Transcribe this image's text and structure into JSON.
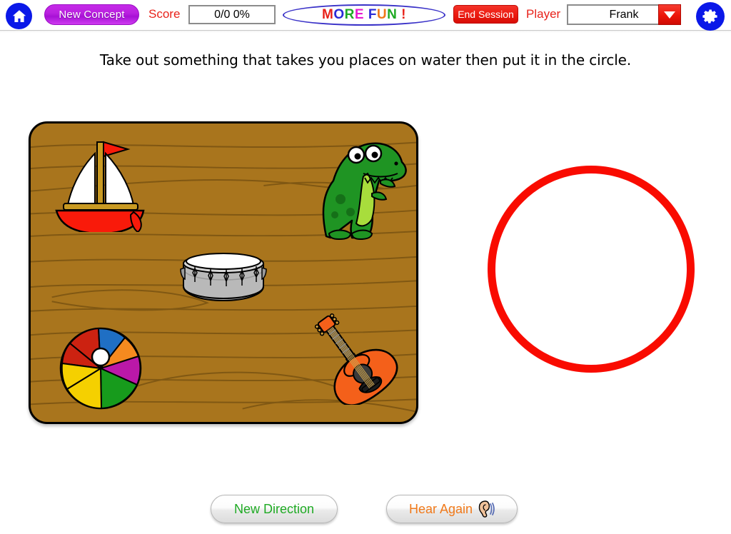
{
  "toolbar": {
    "home_icon": "home-icon",
    "new_concept_label": "New Concept",
    "score_label": "Score",
    "score_value": "0/0  0%",
    "more_fun": {
      "letters": [
        {
          "ch": "M",
          "color": "#e8221a"
        },
        {
          "ch": "O",
          "color": "#2b2bd6"
        },
        {
          "ch": "R",
          "color": "#1faa24"
        },
        {
          "ch": "E",
          "color": "#e81ad0"
        },
        {
          "ch": " ",
          "color": "#000000"
        },
        {
          "ch": "F",
          "color": "#2b2bd6"
        },
        {
          "ch": "U",
          "color": "#f0791a"
        },
        {
          "ch": "N",
          "color": "#1faa24"
        },
        {
          "ch": " ",
          "color": "#000000"
        },
        {
          "ch": "!",
          "color": "#e8221a"
        }
      ]
    },
    "end_session_label": "End Session",
    "player_label": "Player",
    "player_value": "Frank",
    "player_options": [
      "Frank"
    ],
    "dropdown_icon": "chevron-down-icon",
    "gear_icon": "gear-icon"
  },
  "prompt": {
    "text": "Take out something that takes you places on water then put it in the circle."
  },
  "board": {
    "name": "wooden-board",
    "background_color": "#a9751d",
    "grain_color": "#7a5312",
    "border_color": "#000000",
    "objects": [
      {
        "name": "sailboat",
        "label": "sailboat",
        "colors": {
          "hull": "#f91a0a",
          "sail": "#ffffff",
          "mast": "#c99a22",
          "flag": "#f91a0a"
        }
      },
      {
        "name": "dinosaur",
        "label": "dinosaur",
        "colors": {
          "body": "#1f9423",
          "belly": "#a8dd3c",
          "spots": "#157018",
          "eye": "#ffffff"
        }
      },
      {
        "name": "drum",
        "label": "drum",
        "colors": {
          "shell": "#b9b9b9",
          "head": "#ffffff",
          "rim": "#d6d6d6",
          "hardware": "#8f8f8f"
        }
      },
      {
        "name": "beach-ball",
        "label": "beach ball",
        "colors": {
          "red": "#cc2211",
          "yellow": "#f5d000",
          "green": "#179b1c",
          "magenta": "#bb18a8",
          "orange": "#f58a1f",
          "blue": "#1f6fc4",
          "cap": "#ffffff"
        }
      },
      {
        "name": "guitar",
        "label": "guitar",
        "colors": {
          "body": "#f4601a",
          "neck": "#4a4a4a",
          "soundhole": "#3a3a3a",
          "pickguard": "#1c1c1c"
        }
      }
    ]
  },
  "target": {
    "name": "drop-circle",
    "color": "#f90b00",
    "contents": []
  },
  "footer": {
    "new_direction_label": "New Direction",
    "hear_again_label": "Hear Again",
    "hear_again_icon": "ear-icon"
  }
}
